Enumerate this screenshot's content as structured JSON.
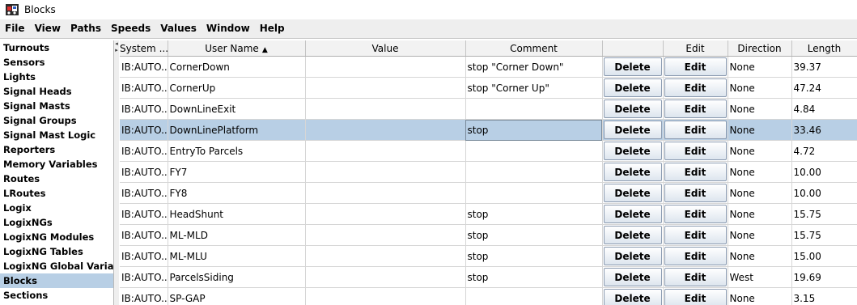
{
  "window": {
    "title": "Blocks",
    "icon": "jmri-locomotive-icon"
  },
  "menu": [
    "File",
    "View",
    "Paths",
    "Speeds",
    "Values",
    "Window",
    "Help"
  ],
  "sidebar": {
    "items": [
      "Turnouts",
      "Sensors",
      "Lights",
      "Signal Heads",
      "Signal Masts",
      "Signal Groups",
      "Signal Mast Logic",
      "Reporters",
      "Memory Variables",
      "Routes",
      "LRoutes",
      "Logix",
      "LogixNGs",
      "LogixNG Modules",
      "LogixNG Tables",
      "LogixNG Global Variables",
      "Blocks",
      "Sections"
    ],
    "selected": "Blocks"
  },
  "table": {
    "columns": [
      "System ...",
      "User Name",
      "Value",
      "Comment",
      "",
      "Edit",
      "Direction",
      "Length"
    ],
    "sort_column": "User Name",
    "sort_direction": "ascending",
    "delete_label": "Delete",
    "edit_label": "Edit",
    "selected_row": 3,
    "rows": [
      {
        "system": "IB:AUTO...",
        "user": "CornerDown",
        "value": "",
        "comment": "stop \"Corner Down\"",
        "direction": "None",
        "length": "39.37"
      },
      {
        "system": "IB:AUTO...",
        "user": "CornerUp",
        "value": "",
        "comment": "stop \"Corner Up\"",
        "direction": "None",
        "length": "47.24"
      },
      {
        "system": "IB:AUTO...",
        "user": "DownLineExit",
        "value": "",
        "comment": "",
        "direction": "None",
        "length": "4.84"
      },
      {
        "system": "IB:AUTO...",
        "user": "DownLinePlatform",
        "value": "",
        "comment": "stop",
        "direction": "None",
        "length": "33.46"
      },
      {
        "system": "IB:AUTO...",
        "user": "EntryTo Parcels",
        "value": "",
        "comment": "",
        "direction": "None",
        "length": "4.72"
      },
      {
        "system": "IB:AUTO...",
        "user": "FY7",
        "value": "",
        "comment": "",
        "direction": "None",
        "length": "10.00"
      },
      {
        "system": "IB:AUTO...",
        "user": "FY8",
        "value": "",
        "comment": "",
        "direction": "None",
        "length": "10.00"
      },
      {
        "system": "IB:AUTO...",
        "user": "HeadShunt",
        "value": "",
        "comment": "stop",
        "direction": "None",
        "length": "15.75"
      },
      {
        "system": "IB:AUTO...",
        "user": "ML-MLD",
        "value": "",
        "comment": "stop",
        "direction": "None",
        "length": "15.75"
      },
      {
        "system": "IB:AUTO...",
        "user": "ML-MLU",
        "value": "",
        "comment": "stop",
        "direction": "None",
        "length": "15.00"
      },
      {
        "system": "IB:AUTO...",
        "user": "ParcelsSiding",
        "value": "",
        "comment": "stop",
        "direction": "West",
        "length": "19.69"
      },
      {
        "system": "IB:AUTO...",
        "user": "SP-GAP",
        "value": "",
        "comment": "",
        "direction": "None",
        "length": "3.15"
      }
    ]
  },
  "colors": {
    "selection": "#b8cfe5",
    "menubar": "#eeeeee"
  }
}
